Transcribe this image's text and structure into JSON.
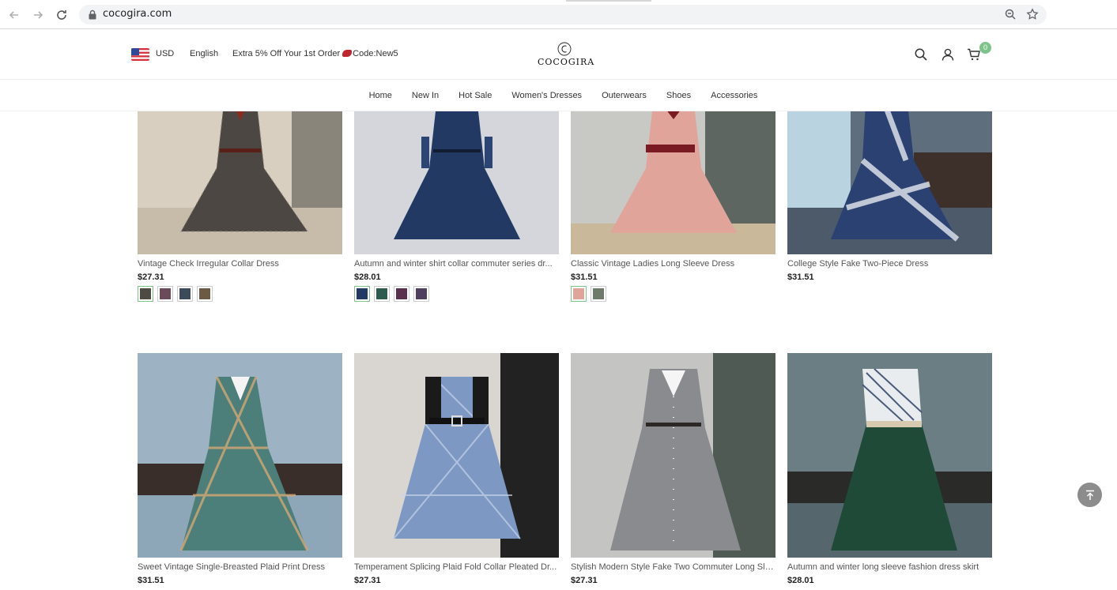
{
  "browser": {
    "url": "cocogira.com"
  },
  "header": {
    "currency": "USD",
    "language": "English",
    "promo_prefix": "Extra 5% Off Your 1st Order",
    "promo_code": "Code:New5",
    "logo_text": "COCOGIRA",
    "cart_count": "0"
  },
  "nav": {
    "items": [
      "Home",
      "New In",
      "Hot Sale",
      "Women's Dresses",
      "Outerwears",
      "Shoes",
      "Accessories"
    ]
  },
  "products": [
    {
      "name": "Vintage Check Irregular Collar Dress",
      "price": "$27.31"
    },
    {
      "name": "Autumn and winter shirt collar commuter series dr...",
      "price": "$28.01"
    },
    {
      "name": "Classic Vintage Ladies Long Sleeve Dress",
      "price": "$31.51"
    },
    {
      "name": "College Style Fake Two-Piece Dress",
      "price": "$31.51"
    },
    {
      "name": "Sweet Vintage Single-Breasted Plaid Print Dress",
      "price": "$31.51"
    },
    {
      "name": "Temperament Splicing Plaid Fold Collar Pleated Dr...",
      "price": "$27.31"
    },
    {
      "name": "Stylish Modern Style Fake Two Commuter Long Sle...",
      "price": "$27.31"
    },
    {
      "name": "Autumn and winter long sleeve fashion dress skirt",
      "price": "$28.01"
    }
  ],
  "colors": {
    "cart_badge": "#7dc38a",
    "promo_badge": "#c0262d",
    "back_to_top": "#8c8c8c"
  }
}
